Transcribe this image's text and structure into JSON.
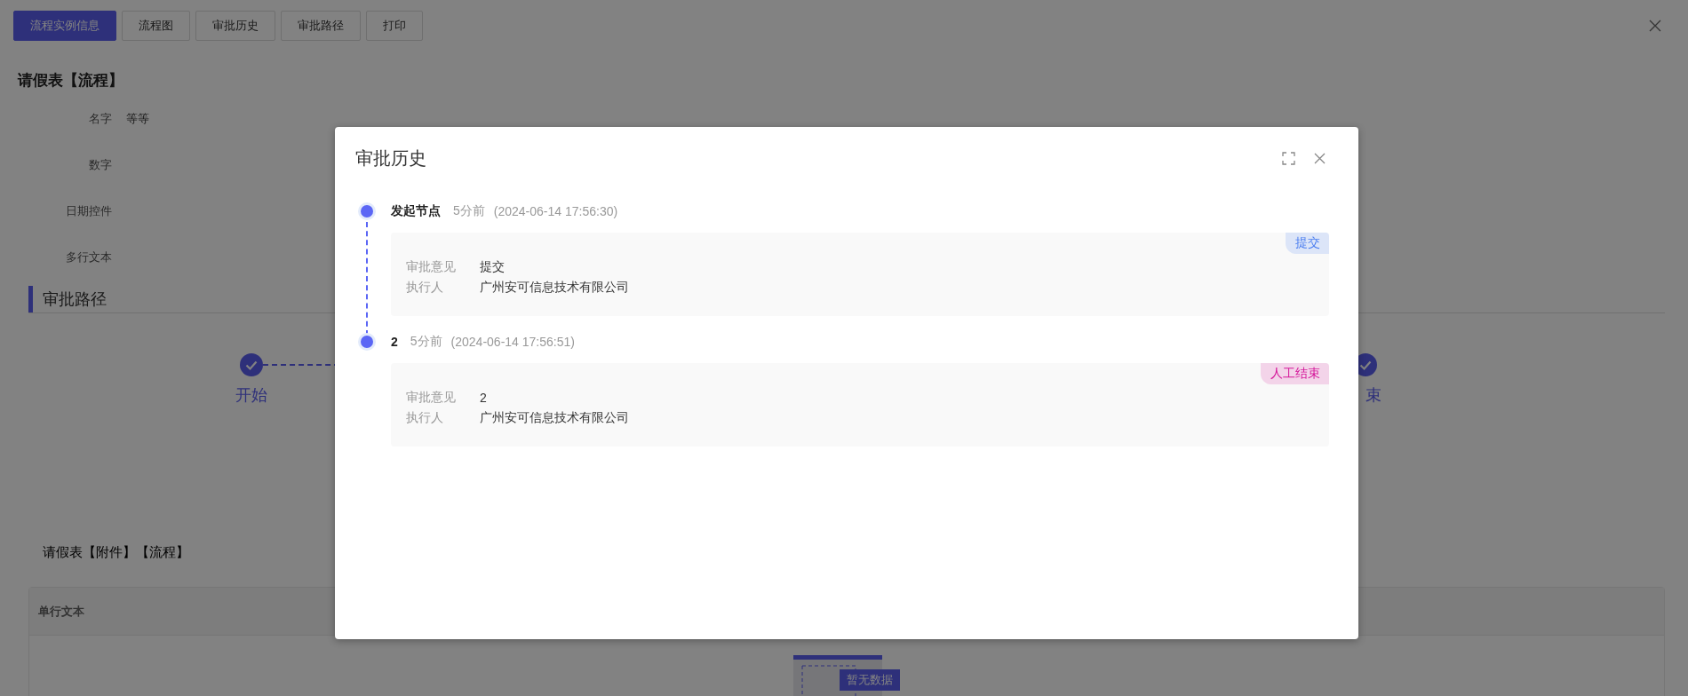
{
  "toolbar": {
    "tabs": [
      {
        "label": "流程实例信息",
        "selected": true
      },
      {
        "label": "流程图",
        "selected": false
      },
      {
        "label": "审批历史",
        "selected": false
      },
      {
        "label": "审批路径",
        "selected": false
      },
      {
        "label": "打印",
        "selected": false
      }
    ]
  },
  "form": {
    "title": "请假表【流程】",
    "fields": [
      {
        "label": "名字",
        "value": "等等"
      },
      {
        "label": "数字"
      },
      {
        "label": "日期控件"
      },
      {
        "label": "多行文本"
      }
    ]
  },
  "approval_path": {
    "title": "审批路径",
    "steps": [
      {
        "label": "开始",
        "done": true
      },
      {
        "label": "束",
        "done": true
      }
    ]
  },
  "attachments": {
    "title": "请假表【附件】【流程】",
    "table": {
      "columns": [
        "单行文本"
      ],
      "empty_text": "暂无数据"
    }
  },
  "dialog": {
    "title": "审批历史",
    "entries": [
      {
        "node": "发起节点",
        "relative_time": "5分前",
        "time": "(2024-06-14 17:56:30)",
        "tag": {
          "label": "提交",
          "color": "#4a7df0"
        },
        "fields": [
          {
            "label": "审批意见",
            "value": "提交"
          },
          {
            "label": "执行人",
            "value": "广州安可信息技术有限公司"
          }
        ]
      },
      {
        "node": "2",
        "relative_time": "5分前",
        "time": "(2024-06-14 17:56:51)",
        "tag": {
          "label": "人工结束",
          "color": "#d5179a"
        },
        "fields": [
          {
            "label": "审批意见",
            "value": "2"
          },
          {
            "label": "执行人",
            "value": "广州安可信息技术有限公司"
          }
        ]
      }
    ]
  }
}
